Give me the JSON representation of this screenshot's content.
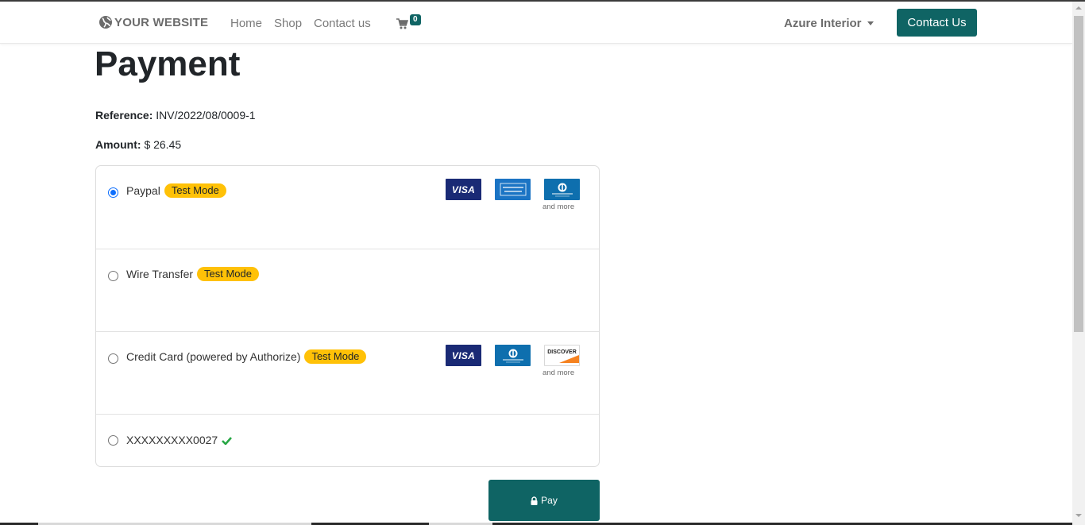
{
  "navbar": {
    "logo_text": "YOUR WEBSITE",
    "links": [
      "Home",
      "Shop",
      "Contact us"
    ],
    "cart_count": "0",
    "company": "Azure Interior",
    "contact_button": "Contact Us"
  },
  "page": {
    "title": "Payment",
    "reference_label": "Reference:",
    "reference_value": "INV/2022/08/0009-1",
    "amount_label": "Amount:",
    "amount_value": "$ 26.45"
  },
  "payment_methods": [
    {
      "name": "Paypal",
      "badge": "Test Mode",
      "selected": true,
      "icons": [
        "visa-card-icon",
        "amex-card-icon",
        "diners-card-icon"
      ],
      "more": "and more"
    },
    {
      "name": "Wire Transfer",
      "badge": "Test Mode",
      "selected": false
    },
    {
      "name": "Credit Card (powered by Authorize)",
      "badge": "Test Mode",
      "selected": false,
      "icons": [
        "visa-card-icon",
        "diners-card-icon",
        "discover-card-icon"
      ],
      "more": "and more"
    },
    {
      "name": "XXXXXXXXX0027",
      "verified": true,
      "selected": false
    }
  ],
  "card_icon_text": {
    "visa": "VISA",
    "discover": "DISCOVER"
  },
  "pay_button": "Pay",
  "colors": {
    "primary": "#0f6464",
    "badge": "#ffc107",
    "radio_selected": "#0d6efd",
    "verified": "#28a745"
  }
}
